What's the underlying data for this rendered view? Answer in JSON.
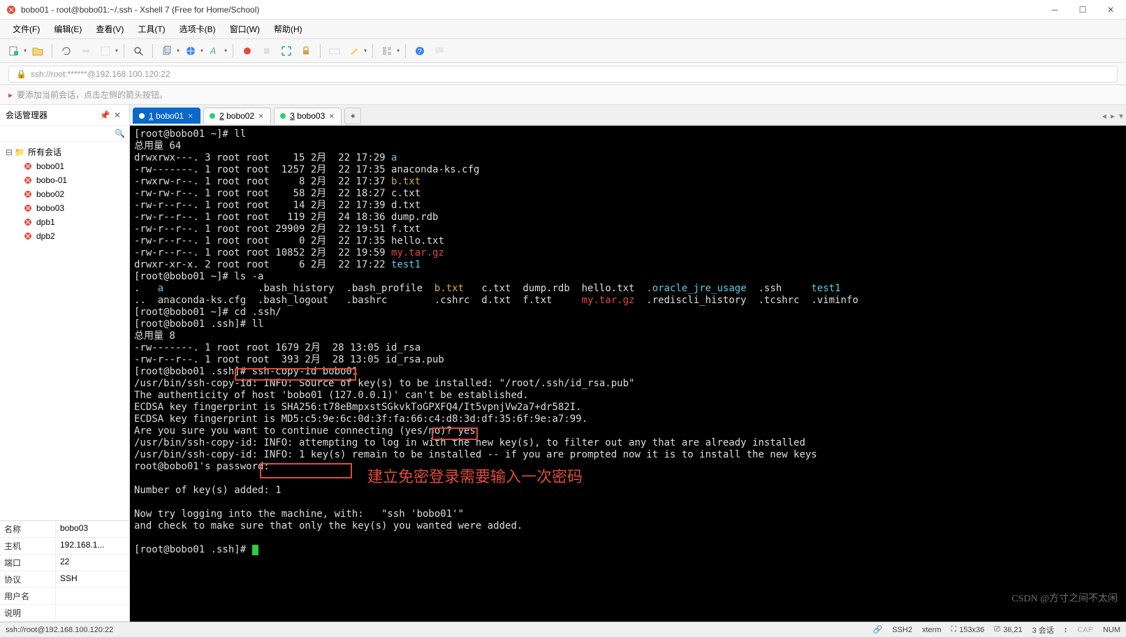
{
  "window": {
    "title": "bobo01 - root@bobo01:~/.ssh - Xshell 7 (Free for Home/School)"
  },
  "menu": [
    "文件(F)",
    "编辑(E)",
    "查看(V)",
    "工具(T)",
    "选项卡(B)",
    "窗口(W)",
    "帮助(H)"
  ],
  "address": {
    "url": "ssh://root:******@192.168.100.120:22"
  },
  "tip": "要添加当前会话，点击左侧的箭头按钮。",
  "sidebar": {
    "title": "会话管理器",
    "root": "所有会话",
    "items": [
      "bobo01",
      "bobo-01",
      "bobo02",
      "bobo03",
      "dpb1",
      "dpb2"
    ]
  },
  "props": {
    "rows": [
      {
        "k": "名称",
        "v": "bobo03"
      },
      {
        "k": "主机",
        "v": "192.168.1..."
      },
      {
        "k": "端口",
        "v": "22"
      },
      {
        "k": "协议",
        "v": "SSH"
      },
      {
        "k": "用户名",
        "v": ""
      },
      {
        "k": "说明",
        "v": ""
      }
    ]
  },
  "tabs": [
    {
      "num": "1",
      "label": "bobo01",
      "active": true
    },
    {
      "num": "2",
      "label": "bobo02",
      "active": false
    },
    {
      "num": "3",
      "label": "bobo03",
      "active": false
    }
  ],
  "term": {
    "l0": "[root@bobo01 ~]# ll",
    "l1": "总用量 64",
    "ls": [
      {
        "perm": "drwxrwx---. 3 root root    15 2月  22 17:29 ",
        "name": "a",
        "cls": "cyan"
      },
      {
        "perm": "-rw-------. 1 root root  1257 2月  22 17:35 ",
        "name": "anaconda-ks.cfg",
        "cls": ""
      },
      {
        "perm": "-rwxrw-r--. 1 root root     8 2月  22 17:37 ",
        "name": "b.txt",
        "cls": "yellow"
      },
      {
        "perm": "-rw-rw-r--. 1 root root    58 2月  22 18:27 ",
        "name": "c.txt",
        "cls": ""
      },
      {
        "perm": "-rw-r--r--. 1 root root    14 2月  22 17:39 ",
        "name": "d.txt",
        "cls": ""
      },
      {
        "perm": "-rw-r--r--. 1 root root   119 2月  24 18:36 ",
        "name": "dump.rdb",
        "cls": ""
      },
      {
        "perm": "-rw-r--r--. 1 root root 29909 2月  22 19:51 ",
        "name": "f.txt",
        "cls": ""
      },
      {
        "perm": "-rw-r--r--. 1 root root     0 2月  22 17:35 ",
        "name": "hello.txt",
        "cls": ""
      },
      {
        "perm": "-rw-r--r--. 1 root root 10852 2月  22 19:59 ",
        "name": "my.tar.gz",
        "cls": "red"
      },
      {
        "perm": "drwxr-xr-x. 2 root root     6 2月  22 17:22 ",
        "name": "test1",
        "cls": "cyan"
      }
    ],
    "lsa_cmd": "[root@bobo01 ~]# ls -a",
    "lsa1": {
      "p1": ".   ",
      "a": "a",
      "p2": "                .bash_history  .bash_profile  ",
      "b": "b.txt",
      "p3": "   c.txt  dump.rdb  hello.txt  ",
      "o": ".oracle_jre_usage",
      "p4": "  .ssh     ",
      "t": "test1"
    },
    "lsa2": {
      "p1": "..  anaconda-ks.cfg  .bash_logout   .bashrc        .cshrc  d.txt  f.txt     ",
      "m": "my.tar.gz",
      "p2": "  .rediscli_history  .tcshrc  .viminfo"
    },
    "cd": "[root@bobo01 ~]# cd .ssh/",
    "ll2": "[root@bobo01 .ssh]# ll",
    "tot2": "总用量 8",
    "k1": "-rw-------. 1 root root 1679 2月  28 13:05 id_rsa",
    "k2": "-rw-r--r--. 1 root root  393 2月  28 13:05 id_rsa.pub",
    "copyid_p": "[root@bobo01 .ssh]#",
    "copyid_c": " ssh-copy-id bobo01",
    "c1": "/usr/bin/ssh-copy-id: INFO: Source of key(s) to be installed: \"/root/.ssh/id_rsa.pub\"",
    "c2": "The authenticity of host 'bobo01 (127.0.0.1)' can't be established.",
    "c3": "ECDSA key fingerprint is SHA256:t78eBmpxstSGkvkToGPXFQ4/It5vpnjVw2a7+dr582I.",
    "c4": "ECDSA key fingerprint is MD5:c5:9e:6c:0d:3f:fa:66:c4:d8:3d:df:35:6f:9e:a7:99.",
    "c5a": "Are you sure you want to continue connecting (yes/no)?",
    "c5b": " yes",
    "c6": "/usr/bin/ssh-copy-id: INFO: attempting to log in with the new key(s), to filter out any that are already installed",
    "c7": "/usr/bin/ssh-copy-id: INFO: 1 key(s) remain to be installed -- if you are prompted now it is to install the new keys",
    "c8": "root@bobo01's password:",
    "c9": "",
    "c10": "Number of key(s) added: 1",
    "c11": "",
    "c12": "Now try logging into the machine, with:   \"ssh 'bobo01'\"",
    "c13": "and check to make sure that only the key(s) you wanted were added.",
    "c14": "",
    "c15": "[root@bobo01 .ssh]# ",
    "annot": "建立免密登录需要输入一次密码"
  },
  "status": {
    "left": "ssh://root@192.168.100.120:22",
    "ssh": "SSH2",
    "term": "xterm",
    "size": "153x36",
    "pos": "36,21",
    "sess": "3 会话",
    "cap": "CAP",
    "num": "NUM"
  },
  "watermark": "CSDN @方寸之间不太闲"
}
